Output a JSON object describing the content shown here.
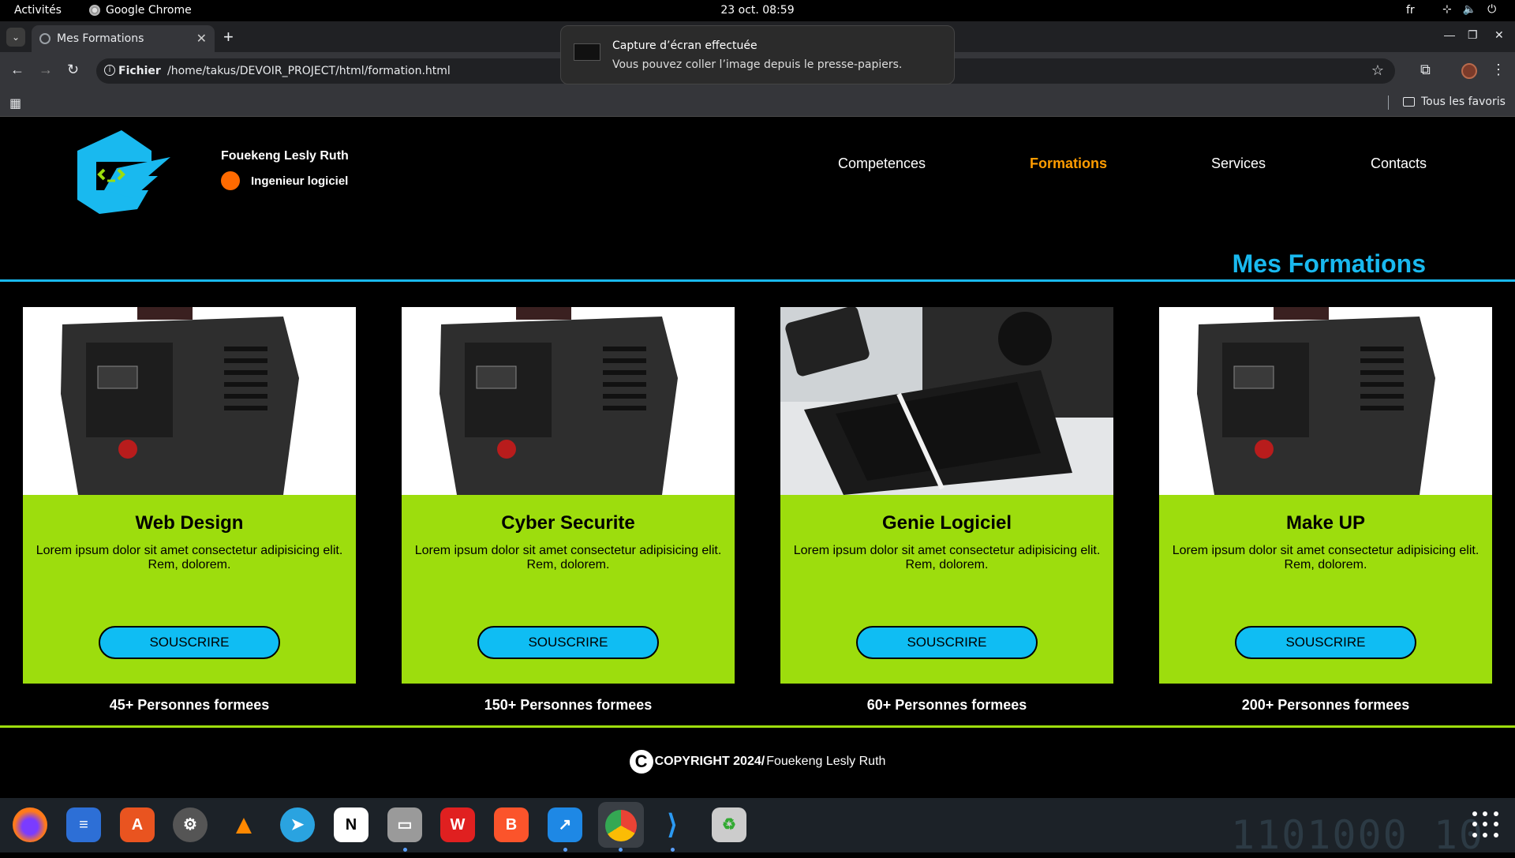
{
  "os": {
    "activities": "Activités",
    "app_name": "Google Chrome",
    "clock": "23 oct.  08:59",
    "language": "fr"
  },
  "browser": {
    "tab_title": "Mes Formations",
    "url_scheme": "Fichier",
    "url": "/home/takus/DEVOIR_PROJECT/html/formation.html",
    "bookmarks_label": "Tous les favoris"
  },
  "notification": {
    "title": "Capture d’écran effectuée",
    "message": "Vous pouvez coller l’image depuis le presse-papiers."
  },
  "site": {
    "author": "Fouekeng Lesly Ruth",
    "role": "Ingenieur logiciel",
    "nav": [
      "Competences",
      "Formations",
      "Services",
      "Contacts"
    ],
    "active_nav": "Formations",
    "section_title": "Mes Formations",
    "cards": [
      {
        "title": "Web Design",
        "text": "Lorem ipsum dolor sit amet consectetur adipisicing elit. Rem, dolorem.",
        "button": "SOUSCRIRE",
        "count": "45+ Personnes formees",
        "image": "power-supply"
      },
      {
        "title": "Cyber Securite",
        "text": "Lorem ipsum dolor sit amet consectetur adipisicing elit. Rem, dolorem.",
        "button": "SOUSCRIRE",
        "count": "150+ Personnes formees",
        "image": "power-supply"
      },
      {
        "title": "Genie Logiciel",
        "text": "Lorem ipsum dolor sit amet consectetur adipisicing elit. Rem, dolorem.",
        "button": "SOUSCRIRE",
        "count": "60+ Personnes formees",
        "image": "tablet-keyboard"
      },
      {
        "title": "Make UP",
        "text": "Lorem ipsum dolor sit amet consectetur adipisicing elit. Rem, dolorem.",
        "button": "SOUSCRIRE",
        "count": "200+ Personnes formees",
        "image": "power-supply"
      }
    ],
    "footer_copyright": "COPYRIGHT 2024/",
    "footer_name": "Fouekeng Lesly Ruth"
  },
  "colors": {
    "accent_blue": "#19b9ef",
    "card_green": "#9ddd0d",
    "active_nav": "#ff9c00",
    "status_dot": "#ff6a00"
  },
  "dock": {
    "apps": [
      "firefox",
      "text-editor",
      "app-center",
      "settings",
      "vlc",
      "telegram",
      "notion",
      "files",
      "wps-office",
      "brave",
      "remote-desktop",
      "chrome",
      "vscode",
      "trash"
    ],
    "background_text": "1101000  10"
  }
}
